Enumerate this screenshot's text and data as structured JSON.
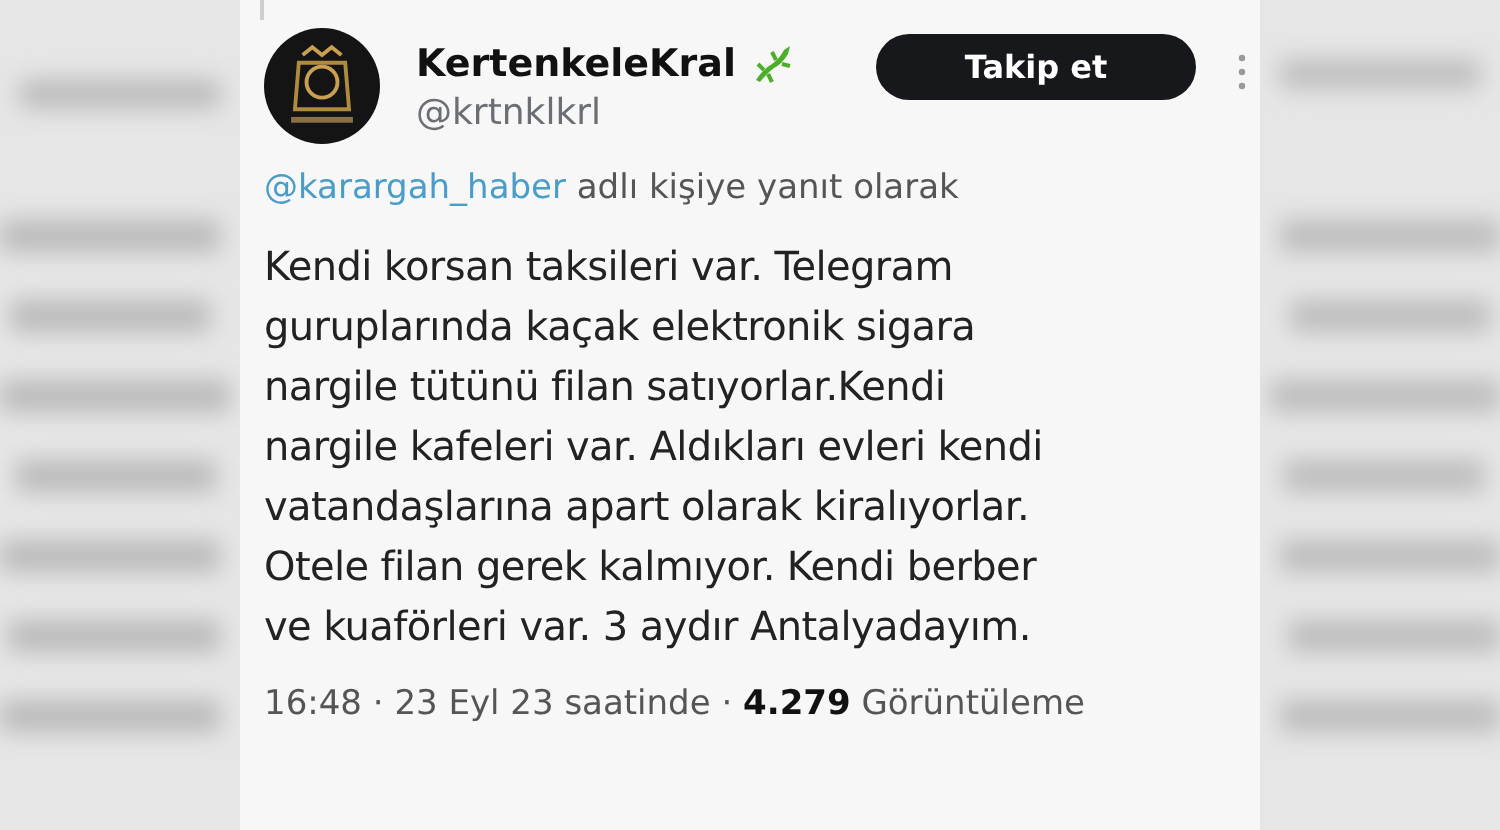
{
  "tweet": {
    "author": {
      "name": "KertenkeleKral",
      "handle": "@krtnklkrl"
    },
    "follow_button": "Takip et",
    "reply_to": {
      "handle": "@karargah_haber",
      "text": "adlı kişiye yanıt olarak"
    },
    "text": "Kendi korsan taksileri var. Telegram\nguruplarında kaçak elektronik sigara\nnargile tütünü filan satıyorlar.Kendi\nnargile kafeleri var. Aldıkları evleri kendi\nvatandaşlarına apart olarak kiralıyorlar.\nOtele filan gerek kalmıyor. Kendi berber\nve kuaförleri var. 3 aydır Antalyadayım.",
    "meta": "16:48 · 23 Eyl 23 saatinde · **4.279** Görüntüleme"
  }
}
